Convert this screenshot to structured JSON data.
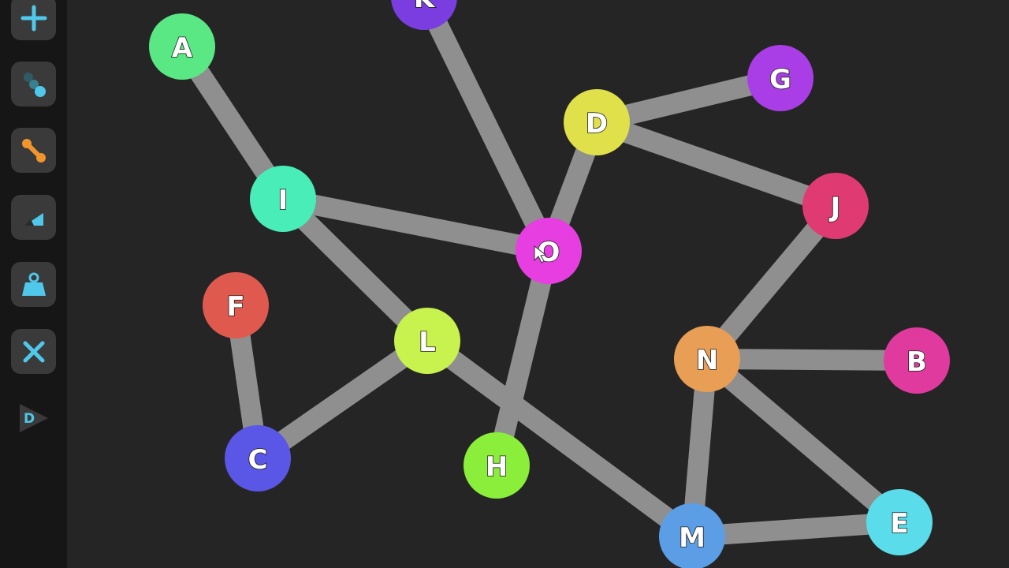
{
  "toolbar": {
    "tools": [
      {
        "id": "add",
        "icon": "plus-icon"
      },
      {
        "id": "nodes",
        "icon": "move-nodes-icon"
      },
      {
        "id": "edge",
        "icon": "edge-icon"
      },
      {
        "id": "direction",
        "icon": "corner-arrow-icon"
      },
      {
        "id": "weight",
        "icon": "weight-icon"
      },
      {
        "id": "delete",
        "icon": "delete-x-icon"
      },
      {
        "id": "run",
        "icon": "run-d-icon",
        "label": "D"
      }
    ]
  },
  "graph": {
    "nodes": [
      {
        "id": "K",
        "label": "K",
        "color": "#7a3ee0"
      },
      {
        "id": "A",
        "label": "A",
        "color": "#5ae884"
      },
      {
        "id": "G",
        "label": "G",
        "color": "#aa3ee6"
      },
      {
        "id": "D",
        "label": "D",
        "color": "#e0e04a"
      },
      {
        "id": "I",
        "label": "I",
        "color": "#48edb8"
      },
      {
        "id": "J",
        "label": "J",
        "color": "#e03a72"
      },
      {
        "id": "O",
        "label": "O",
        "color": "#e63ee0"
      },
      {
        "id": "F",
        "label": "F",
        "color": "#e0594f"
      },
      {
        "id": "L",
        "label": "L",
        "color": "#c8f24e"
      },
      {
        "id": "N",
        "label": "N",
        "color": "#e89e54"
      },
      {
        "id": "B",
        "label": "B",
        "color": "#e03a9e"
      },
      {
        "id": "C",
        "label": "C",
        "color": "#5a56e6"
      },
      {
        "id": "H",
        "label": "H",
        "color": "#8aee3a"
      },
      {
        "id": "M",
        "label": "M",
        "color": "#5c9ee6"
      },
      {
        "id": "E",
        "label": "E",
        "color": "#5adcea"
      }
    ],
    "edges": [
      [
        "K",
        "O"
      ],
      [
        "A",
        "I"
      ],
      [
        "I",
        "O"
      ],
      [
        "I",
        "L"
      ],
      [
        "D",
        "G"
      ],
      [
        "D",
        "J"
      ],
      [
        "D",
        "O"
      ],
      [
        "O",
        "H"
      ],
      [
        "J",
        "N"
      ],
      [
        "N",
        "B"
      ],
      [
        "N",
        "M"
      ],
      [
        "N",
        "E"
      ],
      [
        "M",
        "E"
      ],
      [
        "L",
        "M"
      ],
      [
        "L",
        "C"
      ],
      [
        "F",
        "C"
      ]
    ]
  }
}
